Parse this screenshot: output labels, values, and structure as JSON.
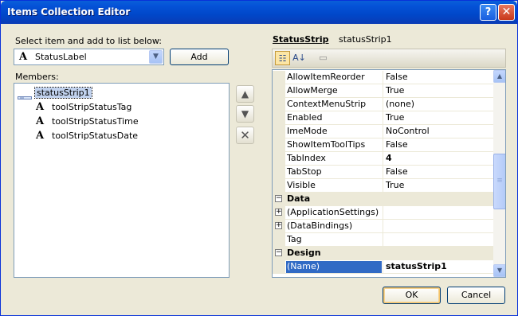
{
  "window": {
    "title": "Items Collection Editor",
    "help_glyph": "?",
    "close_glyph": "✕"
  },
  "left": {
    "select_label": "Select item and add to list below:",
    "combo_value": "StatusLabel",
    "add_label": "Add",
    "members_label": "Members:",
    "members": [
      {
        "text": "statusStrip1",
        "selected": true
      },
      {
        "text": "toolStripStatusTag",
        "selected": false
      },
      {
        "text": "toolStripStatusTime",
        "selected": false
      },
      {
        "text": "toolStripStatusDate",
        "selected": false
      }
    ],
    "type_glyph": "A"
  },
  "right": {
    "type_name": "StatusStrip",
    "instance_name": "statusStrip1",
    "properties": [
      {
        "name": "AllowItemReorder",
        "value": "False",
        "kind": "prop"
      },
      {
        "name": "AllowMerge",
        "value": "True",
        "kind": "prop"
      },
      {
        "name": "ContextMenuStrip",
        "value": "(none)",
        "kind": "prop"
      },
      {
        "name": "Enabled",
        "value": "True",
        "kind": "prop"
      },
      {
        "name": "ImeMode",
        "value": "NoControl",
        "kind": "prop"
      },
      {
        "name": "ShowItemToolTips",
        "value": "False",
        "kind": "prop"
      },
      {
        "name": "TabIndex",
        "value": "4",
        "kind": "prop",
        "bold": true
      },
      {
        "name": "TabStop",
        "value": "False",
        "kind": "prop"
      },
      {
        "name": "Visible",
        "value": "True",
        "kind": "prop"
      },
      {
        "name": "Data",
        "value": "",
        "kind": "cat"
      },
      {
        "name": "(ApplicationSettings)",
        "value": "",
        "kind": "expand"
      },
      {
        "name": "(DataBindings)",
        "value": "",
        "kind": "expand"
      },
      {
        "name": "Tag",
        "value": "",
        "kind": "prop"
      },
      {
        "name": "Design",
        "value": "",
        "kind": "cat"
      },
      {
        "name": "(Name)",
        "value": "statusStrip1",
        "kind": "prop",
        "bold": true,
        "selected": true
      }
    ]
  },
  "footer": {
    "ok_label": "OK",
    "cancel_label": "Cancel"
  },
  "colors": {
    "titlebar": "#0053d8",
    "selection": "#316ac5",
    "window_bg": "#ece9d8"
  }
}
